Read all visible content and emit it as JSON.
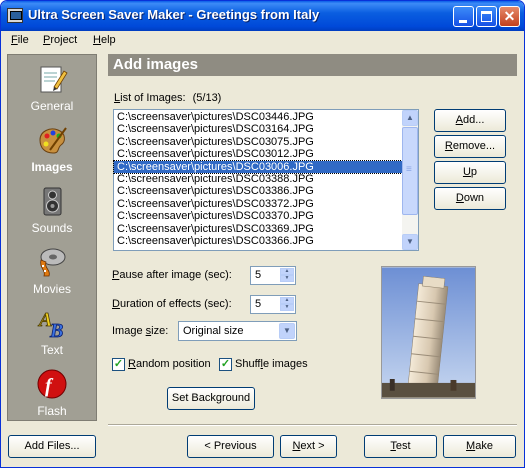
{
  "window": {
    "title": "Ultra Screen Saver Maker - Greetings from Italy"
  },
  "menu": [
    {
      "key": "F",
      "rest": "ile"
    },
    {
      "key": "P",
      "rest": "roject"
    },
    {
      "key": "H",
      "rest": "elp"
    }
  ],
  "sidebar": {
    "items": [
      {
        "label": "General",
        "icon": "notepad-pencil-icon"
      },
      {
        "label": "Images",
        "icon": "paint-palette-icon",
        "active": true
      },
      {
        "label": "Sounds",
        "icon": "speaker-icon"
      },
      {
        "label": "Movies",
        "icon": "film-reel-icon"
      },
      {
        "label": "Text",
        "icon": "text-ab-icon"
      },
      {
        "label": "Flash",
        "icon": "flash-logo-icon"
      }
    ]
  },
  "header": {
    "title": "Add images"
  },
  "list": {
    "label_key": "L",
    "label_rest": "ist of Images:",
    "count": "(5/13)",
    "items": [
      "C:\\screensaver\\pictures\\DSC03446.JPG",
      "C:\\screensaver\\pictures\\DSC03164.JPG",
      "C:\\screensaver\\pictures\\DSC03075.JPG",
      "C:\\screensaver\\pictures\\DSC03012.JPG",
      "C:\\screensaver\\pictures\\DSC03006.JPG",
      "C:\\screensaver\\pictures\\DSC03388.JPG",
      "C:\\screensaver\\pictures\\DSC03386.JPG",
      "C:\\screensaver\\pictures\\DSC03372.JPG",
      "C:\\screensaver\\pictures\\DSC03370.JPG",
      "C:\\screensaver\\pictures\\DSC03369.JPG",
      "C:\\screensaver\\pictures\\DSC03366.JPG"
    ],
    "selected_index": 4
  },
  "list_buttons": {
    "add": {
      "key": "A",
      "rest": "dd..."
    },
    "remove": {
      "key": "R",
      "rest": "emove..."
    },
    "up": {
      "key": "U",
      "rest": "p"
    },
    "down": {
      "key": "D",
      "rest": "own"
    }
  },
  "settings": {
    "pause": {
      "label_key": "P",
      "label_rest": "ause after image (sec):",
      "value": "5"
    },
    "duration": {
      "label_key": "D",
      "label_rest": "uration of effects (sec):",
      "value": "5"
    },
    "image_size": {
      "label_pre": "Image ",
      "label_key": "s",
      "label_rest": "ize:",
      "value": "Original size"
    },
    "random_position": {
      "label_key": "R",
      "label_rest": "andom position",
      "checked": true
    },
    "shuffle_images": {
      "label_pre": "Shuff",
      "label_key": "l",
      "label_rest": "e images",
      "checked": true
    },
    "set_background": "Set Background"
  },
  "footer": {
    "add_files": "Add Files...",
    "previous": "< Previous",
    "next_key": "N",
    "next_rest": "ext >",
    "test_key": "T",
    "test_rest": "est",
    "make_key": "M",
    "make_rest": "ake"
  },
  "colors": {
    "titlebar": "#0049d9",
    "sidebar": "#a19f94",
    "header": "#8f8c82",
    "selection": "#316ac5",
    "window": "#ece9d8"
  }
}
